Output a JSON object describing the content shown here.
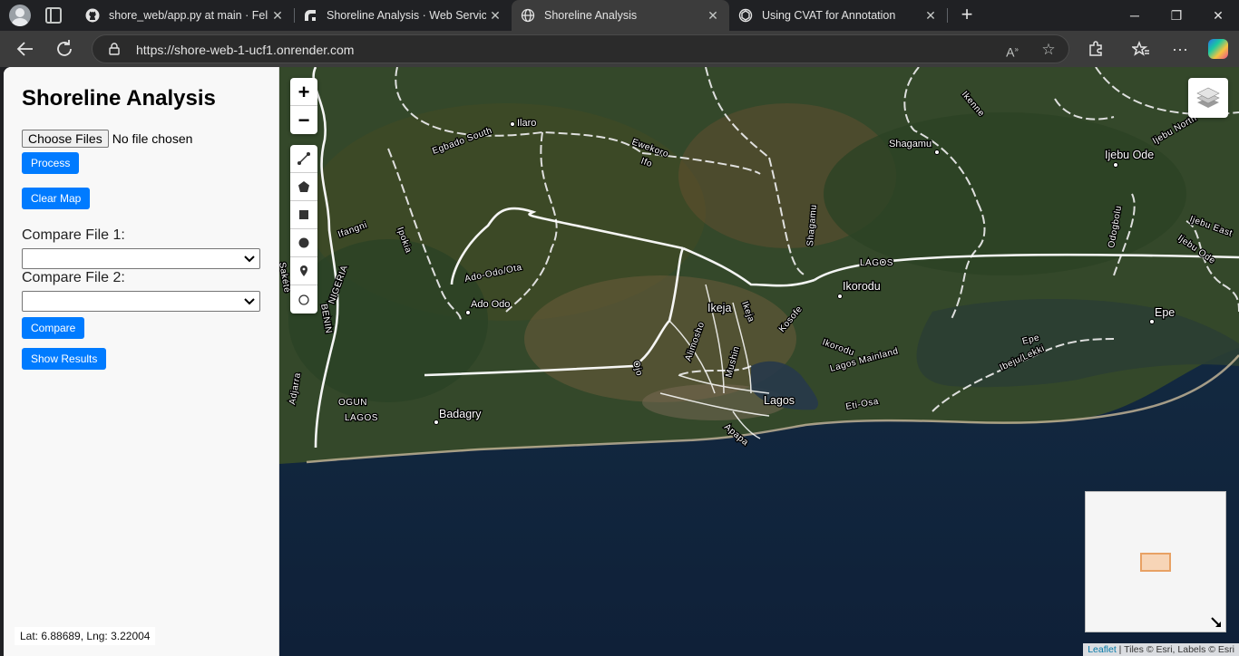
{
  "browser": {
    "tabs": [
      {
        "title": "shore_web/app.py at main · FelixE",
        "icon": "github-icon"
      },
      {
        "title": "Shoreline Analysis · Web Service",
        "icon": "render-icon"
      },
      {
        "title": "Shoreline Analysis",
        "icon": "globe-icon",
        "active": true
      },
      {
        "title": "Using CVAT for Annotation",
        "icon": "openai-icon"
      }
    ],
    "url": "https://shore-web-1-ucf1.onrender.com"
  },
  "sidebar": {
    "title": "Shoreline Analysis",
    "choose_files_label": "Choose Files",
    "no_file_text": "No file chosen",
    "process_label": "Process",
    "clear_map_label": "Clear Map",
    "compare_file_1_label": "Compare File 1:",
    "compare_file_1_value": "",
    "compare_file_2_label": "Compare File 2:",
    "compare_file_2_value": "",
    "compare_label": "Compare",
    "show_results_label": "Show Results",
    "coords": "Lat: 6.88689, Lng: 3.22004"
  },
  "map": {
    "zoom_in": "+",
    "zoom_out": "−",
    "draw_tools": [
      "polyline-icon",
      "polygon-icon",
      "rectangle-icon",
      "circle-icon",
      "marker-icon",
      "circlemarker-icon"
    ],
    "attribution_link": "Leaflet",
    "attribution_text": " | Tiles © Esri, Labels © Esri",
    "places": {
      "ilaro": "Ilaro",
      "egbado_south": "Egbado South",
      "ewekoro": "Ewekoro",
      "ifo": "Ifo",
      "shagamu_town": "Shagamu",
      "ikenne": "Ikenne",
      "ijebu_north": "Ijebu North",
      "ijebu_ode": "Ijebu Ode",
      "ijebu_east": "Ijebu East",
      "ijebu_ode_lga": "Ijebu Ode",
      "odogbolu": "Odogbolu",
      "shagamu_lga": "Shagamu",
      "ifangni": "Ifangni",
      "ipokia": "Ipokia",
      "lagos_state": "LAGOS",
      "ikorodu_town": "Ikorodu",
      "ado_odo_ota": "Ado-Odo/Ota",
      "ado_odo": "Ado Odo",
      "nigeria": "NIGERIA",
      "benin": "BENIN",
      "sakete": "Sakété",
      "ikeja": "Ikeja",
      "ikeja_lga": "Ikeja",
      "kosofe": "Kosofe",
      "epe_town": "Epe",
      "epe_lga": "Epe",
      "alimosho": "Alimosho",
      "mushin": "Mushin",
      "ikorodu_lga": "Ikorodu",
      "lagos_mainland": "Lagos Mainland",
      "ibeju_lekki": "Ibeju/Lekki",
      "ojo": "Ojo",
      "adjarra": "Adjarra",
      "ogun": "OGUN",
      "lagos_state_2": "LAGOS",
      "badagry": "Badagry",
      "lagos_city": "Lagos",
      "eti_osa": "Eti-Osa",
      "apapa": "Apapa"
    }
  }
}
